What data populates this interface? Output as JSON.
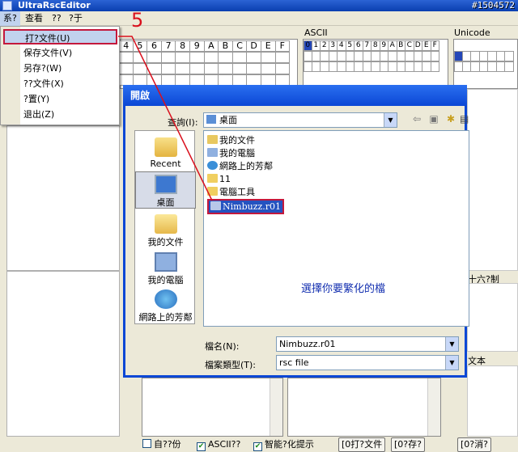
{
  "window": {
    "title": "UltraRscEditor"
  },
  "watermark": "#1504572",
  "menubar": {
    "items": [
      "系?",
      "查看",
      "??",
      "?于"
    ]
  },
  "file_menu": {
    "items": [
      {
        "label": "打?文件(U)",
        "highlighted": true
      },
      {
        "label": "保存文件(V)"
      },
      {
        "label": "另存?(W)"
      },
      {
        "label": "??文件(X)"
      },
      {
        "label": "?置(Y)"
      },
      {
        "label": "退出(Z)"
      }
    ]
  },
  "annotation": {
    "step_number": "5"
  },
  "editor": {
    "hex_headers": [
      "4",
      "5",
      "6",
      "7",
      "8",
      "9",
      "A",
      "B",
      "C",
      "D",
      "E",
      "F"
    ],
    "ascii_label": "ASCII",
    "ascii_headers": [
      "0",
      "1",
      "2",
      "3",
      "4",
      "5",
      "6",
      "7",
      "8",
      "9",
      "A",
      "B",
      "C",
      "D",
      "E",
      "F"
    ],
    "unicode_label": "Unicode",
    "hex_section_label": "十六?制",
    "text_section_label": "文本"
  },
  "dialog": {
    "title": "開啟",
    "look_in_label": "查詢(I):",
    "look_in_value": "桌面",
    "places": [
      {
        "label": "Recent",
        "icon": "recent-folder-icon"
      },
      {
        "label": "桌面",
        "icon": "desktop-icon",
        "selected": true
      },
      {
        "label": "我的文件",
        "icon": "my-documents-icon"
      },
      {
        "label": "我的電腦",
        "icon": "my-computer-icon"
      },
      {
        "label": "網路上的芳鄰",
        "icon": "network-places-icon"
      }
    ],
    "files": [
      {
        "name": "我的文件",
        "icon": "my-documents-icon"
      },
      {
        "name": "我的電腦",
        "icon": "my-computer-icon"
      },
      {
        "name": "網路上的芳鄰",
        "icon": "network-places-icon"
      },
      {
        "name": "11",
        "icon": "folder-icon"
      },
      {
        "name": "電腦工具",
        "icon": "folder-icon"
      },
      {
        "name": "Nimbuzz.r01",
        "icon": "file-icon",
        "selected": true
      }
    ],
    "hint": "選擇你要繁化的檔",
    "filename_label": "檔名(N):",
    "filename_value": "Nimbuzz.r01",
    "filetype_label": "檔案類型(T):",
    "filetype_value": "rsc file"
  },
  "bottom": {
    "checkboxes": [
      {
        "label": "自??份",
        "checked": false
      },
      {
        "label": "ASCII??",
        "checked": true
      },
      {
        "label": "智能?化提示",
        "checked": true
      }
    ],
    "buttons": [
      "[0打?文件",
      "[0?存?",
      "[0?消?"
    ]
  },
  "colors": {
    "highlight_border": "#c4183c",
    "titlebar_blue": "#0b47d5",
    "selection_blue": "#2553c0",
    "annotation_red": "#d9101d"
  }
}
